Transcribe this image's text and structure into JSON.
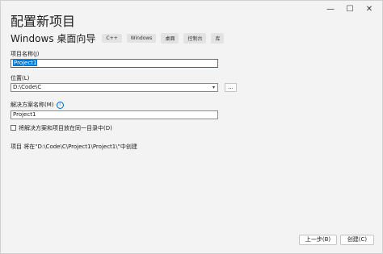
{
  "window": {
    "title": "配置新项目",
    "controls": {
      "minimize": "—",
      "maximize": "☐",
      "close": "✕"
    }
  },
  "header": {
    "subtitle": "Windows 桌面向导",
    "tags": [
      "C++",
      "Windows",
      "桌面",
      "控制台",
      "库"
    ]
  },
  "form": {
    "project_name_label": "项目名称(J)",
    "project_name_value": "Project1",
    "location_label": "位置(L)",
    "location_value": "D:\\Code\\C",
    "browse_label": "...",
    "solution_name_label": "解决方案名称(M)",
    "solution_name_value": "Project1",
    "same_dir_label": "将解决方案和项目放在同一目录中(D)",
    "path_info": "项目 将在\"D:\\Code\\C\\Project1\\Project1\\\"中创建"
  },
  "footer": {
    "prev_label": "上一步(B)",
    "create_label": "创建(C)"
  }
}
